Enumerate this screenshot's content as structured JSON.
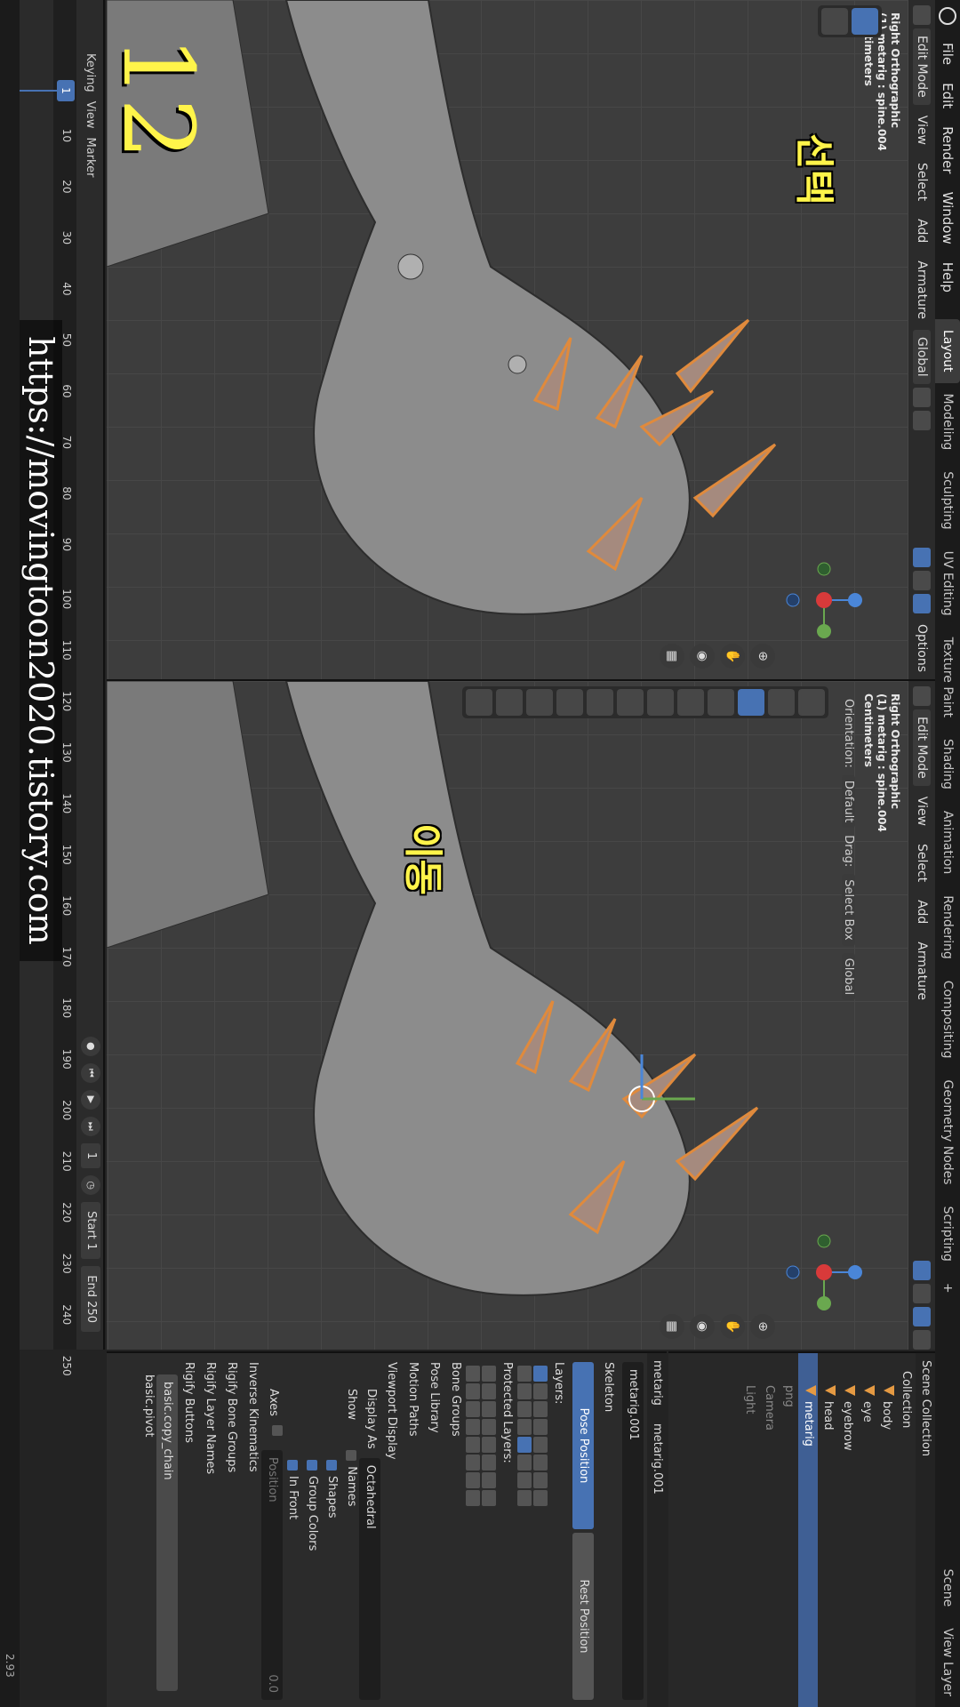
{
  "topbar": {
    "menus": [
      "File",
      "Edit",
      "Render",
      "Window",
      "Help"
    ],
    "workspaces": [
      "Layout",
      "Modeling",
      "Sculpting",
      "UV Editing",
      "Texture Paint",
      "Shading",
      "Animation",
      "Rendering",
      "Compositing",
      "Geometry Nodes",
      "Scripting"
    ],
    "active_workspace": "Layout",
    "add_tab": "+",
    "scene": "Scene",
    "view_layer": "View Layer"
  },
  "viewport_left": {
    "mode": "Edit Mode",
    "menus": [
      "View",
      "Select",
      "Add",
      "Armature"
    ],
    "orientation": "Global",
    "options": "Options",
    "info": [
      "Right Orthographic",
      "(1) metarig : spine.004",
      "Centimeters"
    ],
    "caption": "선택",
    "step_number": "12"
  },
  "viewport_right": {
    "mode": "Edit Mode",
    "menus": [
      "View",
      "Select",
      "Add",
      "Armature"
    ],
    "orientation_label": "Orientation:",
    "orientation": "Default",
    "drag_label": "Drag:",
    "drag": "Select Box",
    "orientation2": "Global",
    "info": [
      "Right Orthographic",
      "(1) metarig : spine.004",
      "Centimeters"
    ],
    "caption": "이동"
  },
  "outliner": {
    "header": "Scene Collection",
    "rows": [
      "Collection",
      "body",
      "eye",
      "eyebrow",
      "head",
      "metarig",
      "png",
      "Camera",
      "Light"
    ]
  },
  "properties": {
    "object": "metarig",
    "data": "metarig.001",
    "data_field": "metarig.001",
    "skeleton": "Skeleton",
    "pose_position": "Pose Position",
    "rest_position": "Rest Position",
    "layers": "Layers:",
    "protected_layers": "Protected Layers:",
    "sections": [
      "Bone Groups",
      "Pose Library",
      "Motion Paths",
      "Viewport Display"
    ],
    "display_as_label": "Display As",
    "display_as": "Octahedral",
    "show_label": "Show",
    "show_names": "Names",
    "show_shapes": "Shapes",
    "show_group_colors": "Group Colors",
    "in_front": "In Front",
    "axes": "Axes",
    "position": "Position",
    "position_value": "0.0",
    "more_sections": [
      "Inverse Kinematics",
      "Rigify Bone Groups",
      "Rigify Layer Names",
      "Rigify Buttons"
    ],
    "rigify_items": [
      "basic.copy_chain",
      "basic.pivot"
    ]
  },
  "timeline": {
    "menus": [
      "Keying",
      "View",
      "Marker"
    ],
    "current_frame": "1",
    "ticks": [
      "1",
      "10",
      "20",
      "30",
      "40",
      "50",
      "60",
      "70",
      "80",
      "90",
      "100",
      "110",
      "120",
      "130",
      "140",
      "150",
      "160",
      "170",
      "180",
      "190",
      "200",
      "210",
      "220",
      "230",
      "240",
      "250"
    ],
    "frame_box": "1",
    "start_label": "Start",
    "start": "1",
    "end_label": "End",
    "end": "250"
  },
  "watermark": "https://movingtoon2020.tistory.com",
  "version": "2.93"
}
